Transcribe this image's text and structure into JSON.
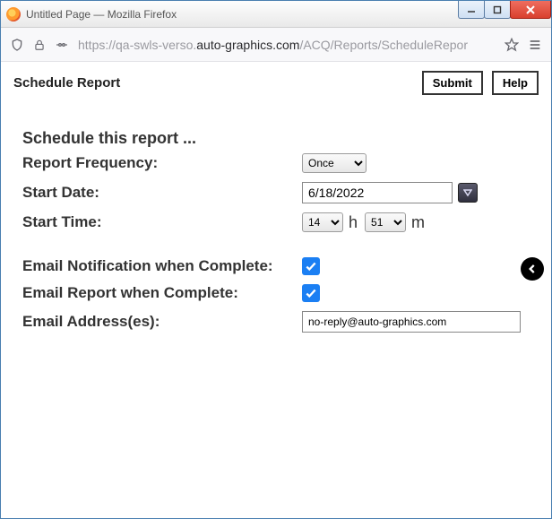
{
  "window": {
    "title": "Untitled Page — Mozilla Firefox"
  },
  "address": {
    "prefix": "https://qa-swls-verso.",
    "host": "auto-graphics.com",
    "suffix": "/ACQ/Reports/ScheduleRepor"
  },
  "header": {
    "title": "Schedule Report",
    "submit": "Submit",
    "help": "Help"
  },
  "form": {
    "section": "Schedule this report ...",
    "freq_label": "Report Frequency:",
    "freq_value": "Once",
    "start_date_label": "Start Date:",
    "start_date_value": "6/18/2022",
    "start_time_label": "Start Time:",
    "hour_value": "14",
    "hour_unit": "h",
    "minute_value": "51",
    "minute_unit": "m",
    "email_notify_label": "Email Notification when Complete:",
    "email_report_label": "Email Report when Complete:",
    "email_addr_label": "Email Address(es):",
    "email_addr_value": "no-reply@auto-graphics.com"
  }
}
